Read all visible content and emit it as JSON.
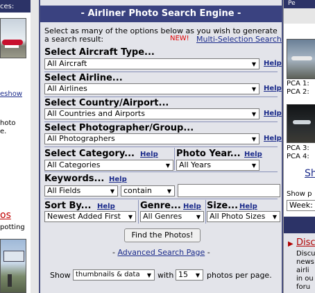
{
  "left": {
    "top_text": "ces:",
    "link_slideshow": "eshow",
    "text_photo": "hoto",
    "text_e": "e.",
    "link_os": "os",
    "text_spotting": "potting"
  },
  "search": {
    "title": "- Airliner Photo Search Engine -",
    "intro": "Select as many of the options below as you wish to generate",
    "intro2": "a search result:",
    "new_badge": "NEW!",
    "multi_link": "Multi-Selection Search",
    "help": "Help",
    "aircraft": {
      "label": "Select Aircraft Type...",
      "value": "All Aircraft"
    },
    "airline": {
      "label": "Select Airline...",
      "value": "All Airlines"
    },
    "country": {
      "label": "Select Country/Airport...",
      "value": "All Countries and Airports"
    },
    "photographer": {
      "label": "Select Photographer/Group...",
      "value": "All Photographers"
    },
    "category": {
      "label": "Select Category...",
      "value": "All Categories"
    },
    "year": {
      "label": "Photo Year...",
      "value": "All Years"
    },
    "keywords": {
      "label": "Keywords...",
      "field": "All Fields",
      "mode": "contain",
      "text": ""
    },
    "sort": {
      "label": "Sort By...",
      "value": "Newest Added First"
    },
    "genre": {
      "label": "Genre...",
      "value": "All Genres"
    },
    "size": {
      "label": "Size...",
      "value": "All Photo Sizes"
    },
    "submit": "Find the Photos!",
    "advanced_prefix": "- ",
    "advanced_link": "Advanced Search Page",
    "advanced_suffix": " -",
    "show_label": "Show",
    "show_mode": "thumbnails & data",
    "with_label": "with",
    "per_page": "15",
    "per_page_suffix": "photos per page."
  },
  "right": {
    "top_text": "Pe",
    "pca1": "PCA 1:",
    "pca2": "PCA 2:",
    "pca3": "PCA 3:",
    "pca4": "PCA 4:",
    "sh": "Sh",
    "show_p": "Show p",
    "week": "Week:",
    "disc": "Disc",
    "line1": "Discu",
    "line2": "news",
    "line3": "airli",
    "line4": "in ou",
    "line5": "foru"
  }
}
